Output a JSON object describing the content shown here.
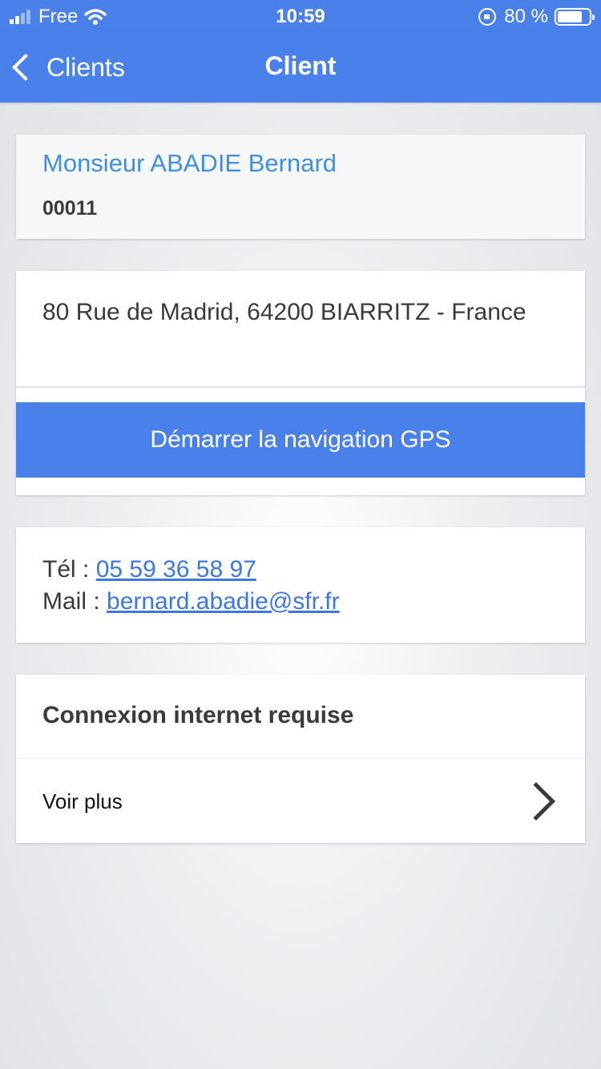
{
  "status_bar": {
    "carrier": "Free",
    "time": "10:59",
    "battery_percent": "80 %",
    "battery_level": 0.8,
    "signal_bars_active": 2,
    "signal_bars_total": 4
  },
  "nav": {
    "back_label": "Clients",
    "title": "Client"
  },
  "client": {
    "name": "Monsieur ABADIE Bernard",
    "code": "00011"
  },
  "address": {
    "text": "80 Rue de Madrid, 64200 BIARRITZ - France",
    "gps_button_label": "Démarrer la navigation GPS"
  },
  "contact": {
    "tel_label": "Tél : ",
    "tel_value": "05 59 36 58 97",
    "mail_label": "Mail : ",
    "mail_value": "bernard.abadie@sfr.fr"
  },
  "internet": {
    "title": "Connexion internet requise",
    "more_label": "Voir plus"
  },
  "colors": {
    "accent": "#4a80ea",
    "name_blue": "#3d8fe0",
    "link_blue": "#3d78e0"
  }
}
